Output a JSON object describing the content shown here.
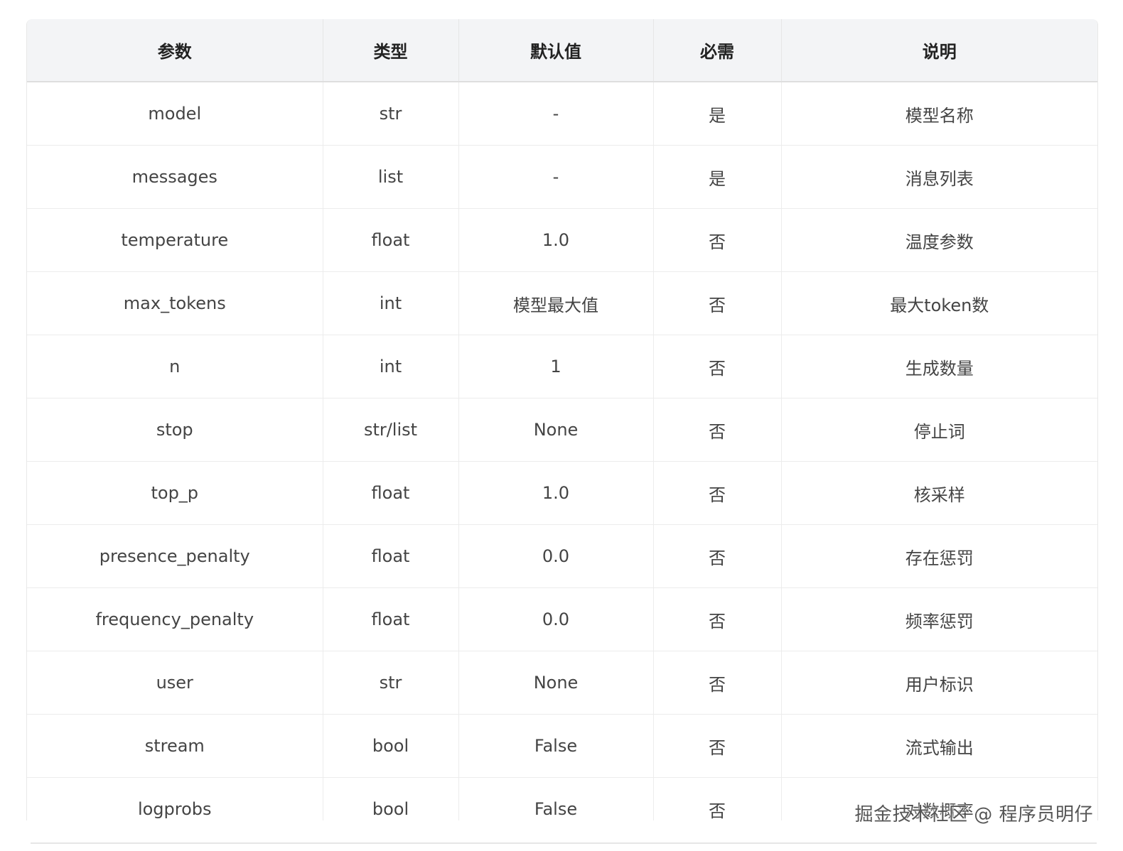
{
  "table": {
    "headers": [
      "参数",
      "类型",
      "默认值",
      "必需",
      "说明"
    ],
    "rows": [
      [
        "model",
        "str",
        "-",
        "是",
        "模型名称"
      ],
      [
        "messages",
        "list",
        "-",
        "是",
        "消息列表"
      ],
      [
        "temperature",
        "float",
        "1.0",
        "否",
        "温度参数"
      ],
      [
        "max_tokens",
        "int",
        "模型最大值",
        "否",
        "最大token数"
      ],
      [
        "n",
        "int",
        "1",
        "否",
        "生成数量"
      ],
      [
        "stop",
        "str/list",
        "None",
        "否",
        "停止词"
      ],
      [
        "top_p",
        "float",
        "1.0",
        "否",
        "核采样"
      ],
      [
        "presence_penalty",
        "float",
        "0.0",
        "否",
        "存在惩罚"
      ],
      [
        "frequency_penalty",
        "float",
        "0.0",
        "否",
        "频率惩罚"
      ],
      [
        "user",
        "str",
        "None",
        "否",
        "用户标识"
      ],
      [
        "stream",
        "bool",
        "False",
        "否",
        "流式输出"
      ],
      [
        "logprobs",
        "bool",
        "False",
        "否",
        "对数概率"
      ]
    ]
  },
  "watermark": "掘金技术社区 @ 程序员明仔"
}
